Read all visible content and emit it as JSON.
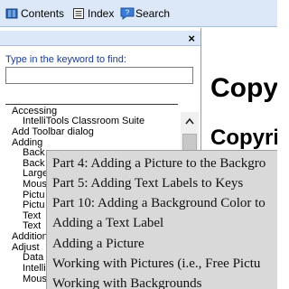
{
  "toolbar": {
    "contents_label": "Contents",
    "index_label": "Index",
    "search_label": "Search"
  },
  "index_pane": {
    "close_glyph": "×",
    "keyword_label": "Type in the keyword to find:",
    "keyword_value": "",
    "items": [
      "Accessing",
      "IntelliTools Classroom Suite",
      "Add Toolbar dialog",
      "Adding",
      "Back",
      "Back",
      "Large",
      "Mous",
      "Pictu",
      "Pictu",
      "Text",
      "Text",
      "Addition",
      "Adjust",
      "Data",
      "Intelli",
      "Mous"
    ]
  },
  "content": {
    "heading": "Copy",
    "subheading": "Copyri"
  },
  "popup": {
    "items": [
      "Part 4: Adding a Picture to the Backgro",
      "Part 5: Adding Text Labels to Keys",
      "Part 10: Adding a Background Color to",
      "Adding a Text Label",
      "Adding a Picture",
      "Working with Pictures (i.e., Free Pictu",
      "Working with Backgrounds"
    ]
  }
}
